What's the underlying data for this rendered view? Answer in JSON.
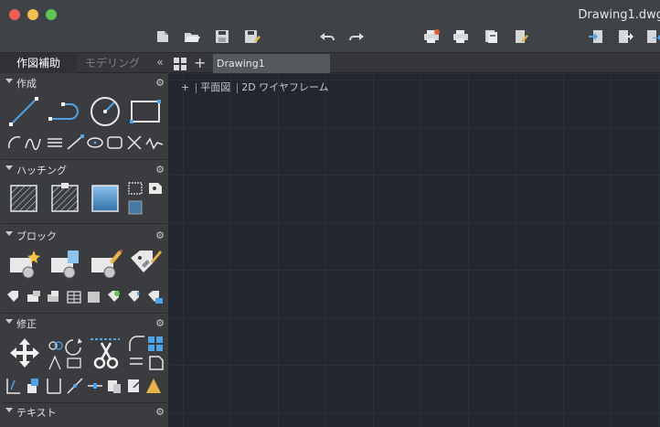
{
  "window": {
    "title": "Drawing1.dwg"
  },
  "toolbar": {
    "items": [
      "new-file-icon",
      "open-folder-icon",
      "save-icon",
      "save-as-icon",
      "undo-icon",
      "redo-icon",
      "plot-icon",
      "batch-plot-icon",
      "publish-icon",
      "sheet-set-icon",
      "import-icon",
      "export-icon",
      "share-icon"
    ]
  },
  "palette_tabs": {
    "drafting": "作図補助",
    "modeling": "モデリング",
    "collapse": "«"
  },
  "doc_tabs": {
    "add": "+",
    "active": "Drawing1"
  },
  "sections": {
    "create": "作成",
    "hatch": "ハッチング",
    "block": "ブロック",
    "modify": "修正",
    "text": "テキスト"
  },
  "viewport": {
    "prefix": "+",
    "view": "平面図",
    "style": "2D ワイヤフレーム"
  },
  "colors": {
    "accent": "#4fa3e8",
    "canvas": "#212630",
    "panel": "#3a3c40"
  }
}
